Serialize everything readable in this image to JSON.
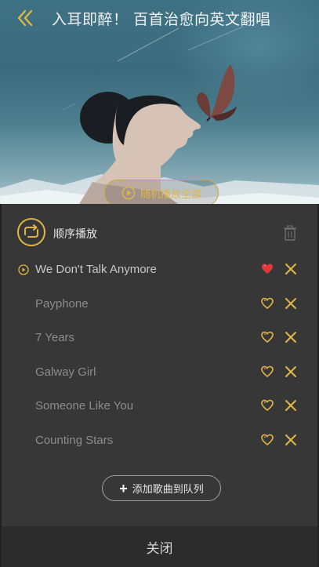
{
  "header": {
    "title": "入耳即醉！ 百首治愈向英文翻唱",
    "back_icon": "chevron-double-left-icon"
  },
  "hero": {
    "shuffle_all_label": "随机播放全部",
    "shuffle_all_icon": "play-circle-icon"
  },
  "playlist": {
    "mode_label": "顺序播放",
    "mode_icon": "repeat-sequence-icon",
    "clear_icon": "trash-icon",
    "songs": [
      {
        "title": "We Don't Talk Anymore",
        "playing": true,
        "liked": true
      },
      {
        "title": "Payphone",
        "playing": false,
        "liked": false
      },
      {
        "title": "7 Years",
        "playing": false,
        "liked": false
      },
      {
        "title": "Galway Girl",
        "playing": false,
        "liked": false
      },
      {
        "title": "Someone Like You",
        "playing": false,
        "liked": false
      },
      {
        "title": "Counting Stars",
        "playing": false,
        "liked": false
      }
    ],
    "add_to_queue_label": "添加歌曲到队列"
  },
  "footer": {
    "close_label": "关闭"
  },
  "colors": {
    "accent": "#e0b645",
    "liked": "#e0393b",
    "panel_bg": "#373737",
    "close_bar_bg": "#2c2c2c"
  }
}
